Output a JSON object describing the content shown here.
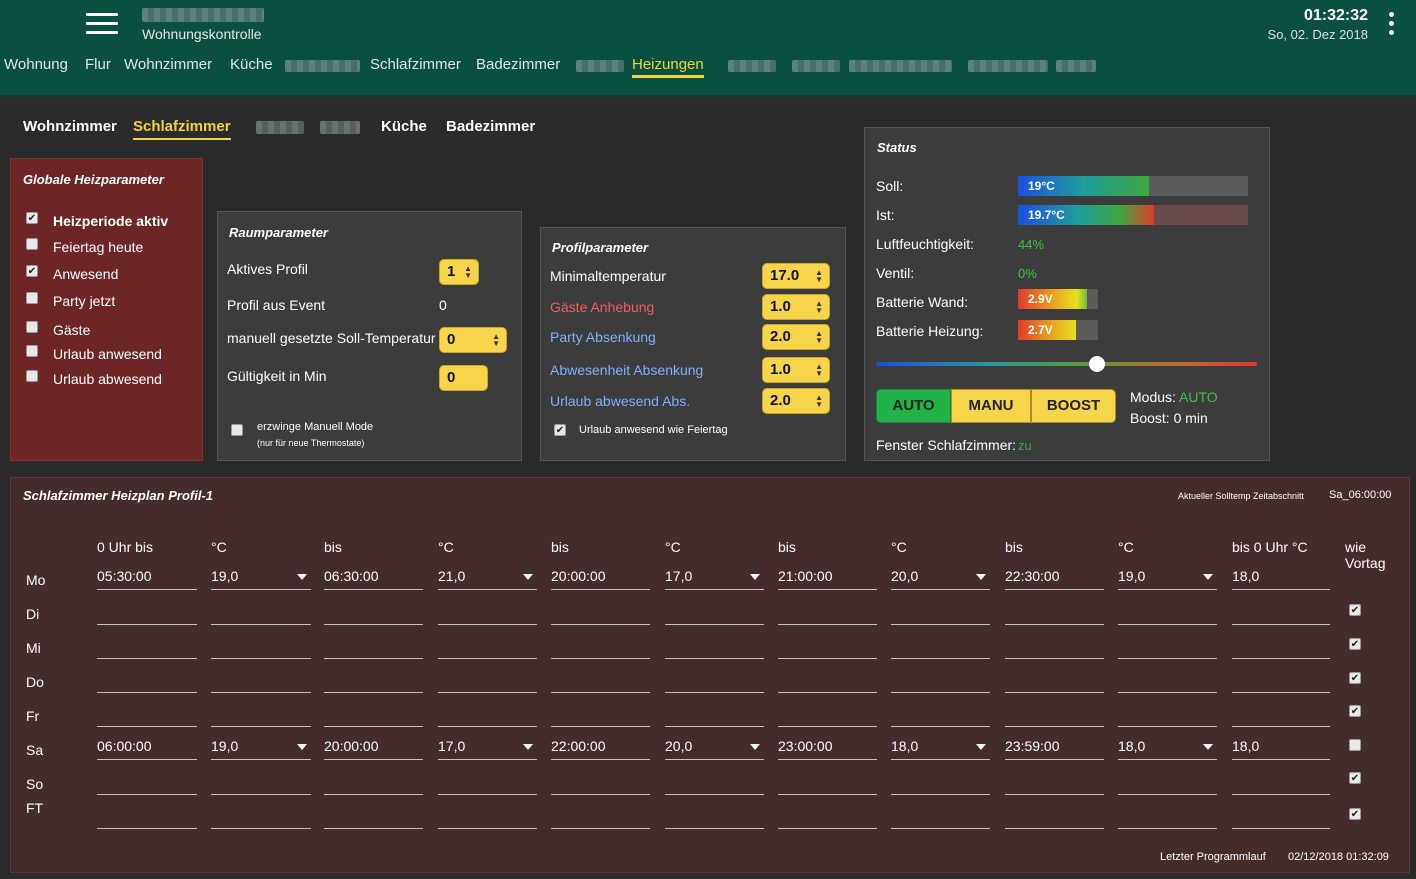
{
  "header": {
    "app_title": "Wohnungskontrolle",
    "time": "01:32:32",
    "date": "So, 02. Dez 2018",
    "nav": [
      {
        "label": "Wohnung"
      },
      {
        "label": "Flur"
      },
      {
        "label": "Wohnzimmer"
      },
      {
        "label": "Küche"
      },
      {
        "label": "Schlafzimmer"
      },
      {
        "label": "Badezimmer"
      },
      {
        "label": "Heizungen",
        "active": true
      }
    ]
  },
  "rooms": {
    "tabs": [
      {
        "label": "Wohnzimmer"
      },
      {
        "label": "Schlafzimmer",
        "active": true
      },
      {
        "label": "Küche"
      },
      {
        "label": "Badezimmer"
      }
    ]
  },
  "global": {
    "title": "Globale Heizparameter",
    "items": [
      {
        "label": "Heizperiode aktiv",
        "checked": true
      },
      {
        "label": "Feiertag heute",
        "checked": false
      },
      {
        "label": "Anwesend",
        "checked": true
      },
      {
        "label": "Party jetzt",
        "checked": false
      },
      {
        "label": "Gäste",
        "checked": false
      },
      {
        "label": "Urlaub anwesend",
        "checked": false
      },
      {
        "label": "Urlaub abwesend",
        "checked": false
      }
    ]
  },
  "room_params": {
    "title": "Raumparameter",
    "active_profile_label": "Aktives Profil",
    "active_profile_value": "1",
    "profile_event_label": "Profil aus Event",
    "profile_event_value": "0",
    "manual_temp_label": "manuell gesetzte Soll-Temperatur",
    "manual_temp_value": "0",
    "validity_label": "Gültigkeit in Min",
    "validity_value": "0",
    "force_manual_label": "erzwinge Manuell Mode",
    "force_manual_note": "(nur für neue Thermostate)"
  },
  "profile_params": {
    "title": "Profilparameter",
    "rows": [
      {
        "label": "Minimaltemperatur",
        "value": "17.0",
        "color": "#ffffff"
      },
      {
        "label": "Gäste Anhebung",
        "value": "1.0",
        "color": "#f06060"
      },
      {
        "label": "Party Absenkung",
        "value": "2.0",
        "color": "#7fb2ff"
      },
      {
        "label": "Abwesenheit Absenkung",
        "value": "1.0",
        "color": "#7fb2ff"
      },
      {
        "label": "Urlaub abwesend Abs.",
        "value": "2.0",
        "color": "#7fb2ff"
      }
    ],
    "holiday_label": "Urlaub anwesend wie Feiertag"
  },
  "status": {
    "title": "Status",
    "soll_label": "Soll:",
    "soll_value": "19°C",
    "soll_level": 0.57,
    "ist_label": "Ist:",
    "ist_value": "19.7°C",
    "ist_level": 0.59,
    "humidity_label": "Luftfeuchtigkeit:",
    "humidity_value": "44%",
    "valve_label": "Ventil:",
    "valve_value": "0%",
    "bat_wall_label": "Batterie Wand:",
    "bat_wall_value": "2.9V",
    "bat_wall_level": 0.86,
    "bat_heat_label": "Batterie Heizung:",
    "bat_heat_value": "2.7V",
    "bat_heat_level": 0.72,
    "slider_level": 0.58,
    "mode_auto": "AUTO",
    "mode_manu": "MANU",
    "mode_boost": "BOOST",
    "modus_label": "Modus:",
    "modus_value": "AUTO",
    "boost_label": "Boost: 0 min",
    "window_label": "Fenster Schlafzimmer:",
    "window_value": "zu",
    "green": "#3fc43f"
  },
  "plan": {
    "title": "Schlafzimmer Heizplan Profil-1",
    "current_label": "Aktueller Solltemp Zeitabschnitt",
    "current_value": "Sa_06:00:00",
    "headers": [
      "0 Uhr bis",
      "°C",
      "bis",
      "°C",
      "bis",
      "°C",
      "bis",
      "°C",
      "bis",
      "°C",
      "bis 0 Uhr °C"
    ],
    "wie_label": "wie",
    "vortag_label": "Vortag",
    "days": [
      {
        "label": "Mo",
        "cells": [
          "05:30:00",
          "19,0",
          "06:30:00",
          "21,0",
          "20:00:00",
          "17,0",
          "21:00:00",
          "20,0",
          "22:30:00",
          "19,0",
          "18,0"
        ],
        "same": null
      },
      {
        "label": "Di",
        "cells": [
          "",
          "",
          "",
          "",
          "",
          "",
          "",
          "",
          "",
          "",
          ""
        ],
        "same": true
      },
      {
        "label": "Mi",
        "cells": [
          "",
          "",
          "",
          "",
          "",
          "",
          "",
          "",
          "",
          "",
          ""
        ],
        "same": true
      },
      {
        "label": "Do",
        "cells": [
          "",
          "",
          "",
          "",
          "",
          "",
          "",
          "",
          "",
          "",
          ""
        ],
        "same": true
      },
      {
        "label": "Fr",
        "cells": [
          "",
          "",
          "",
          "",
          "",
          "",
          "",
          "",
          "",
          "",
          ""
        ],
        "same": true
      },
      {
        "label": "Sa",
        "cells": [
          "06:00:00",
          "19,0",
          "20:00:00",
          "17,0",
          "22:00:00",
          "20,0",
          "23:00:00",
          "18,0",
          "23:59:00",
          "18,0",
          "18,0"
        ],
        "same": false
      },
      {
        "label": "So",
        "cells": [
          "",
          "",
          "",
          "",
          "",
          "",
          "",
          "",
          "",
          "",
          ""
        ],
        "same": true
      },
      {
        "label": "FT",
        "cells": [
          "",
          "",
          "",
          "",
          "",
          "",
          "",
          "",
          "",
          "",
          ""
        ],
        "same": true
      }
    ],
    "last_run_label": "Letzter Programmlauf",
    "last_run_value": "02/12/2018 01:32:09"
  }
}
